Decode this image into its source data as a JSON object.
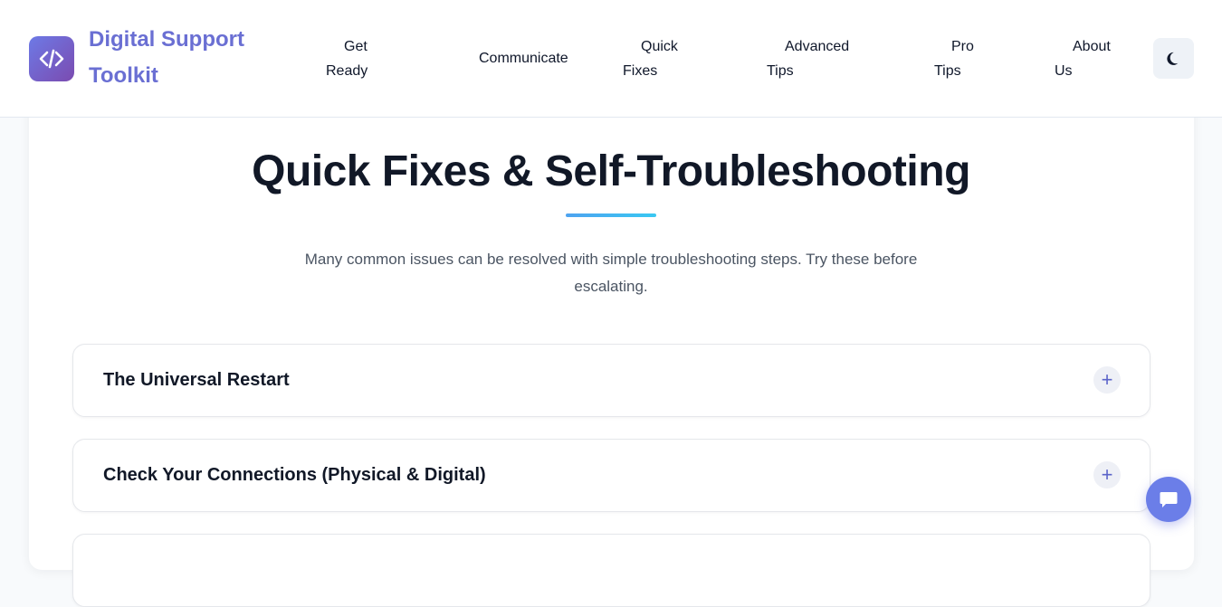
{
  "header": {
    "brand_name": "Digital Support Toolkit",
    "logo_icon": "code-icon",
    "nav": [
      {
        "line1": "Get",
        "line2": "Ready"
      },
      {
        "line1": "Communicate",
        "line2": ""
      },
      {
        "line1": "Quick",
        "line2": "Fixes"
      },
      {
        "line1": "Advanced",
        "line2": "Tips"
      },
      {
        "line1": "Pro",
        "line2": "Tips"
      },
      {
        "line1": "About",
        "line2": "Us"
      }
    ],
    "theme_icon": "moon-icon"
  },
  "section": {
    "title": "Quick Fixes & Self-Troubleshooting",
    "subtitle": "Many common issues can be resolved with simple troubleshooting steps. Try these before escalating."
  },
  "accordion": [
    {
      "title": "The Universal Restart",
      "toggle": "+"
    },
    {
      "title": "Check Your Connections (Physical & Digital)",
      "toggle": "+"
    },
    {
      "title": "",
      "toggle": ""
    }
  ],
  "chat": {
    "icon": "chat-bubble-icon"
  },
  "colors": {
    "brand": "#6a6fd3",
    "accent_gradient_start": "#4ea3f0",
    "accent_gradient_end": "#39c8f2",
    "chat_button": "#6b7ee8"
  }
}
